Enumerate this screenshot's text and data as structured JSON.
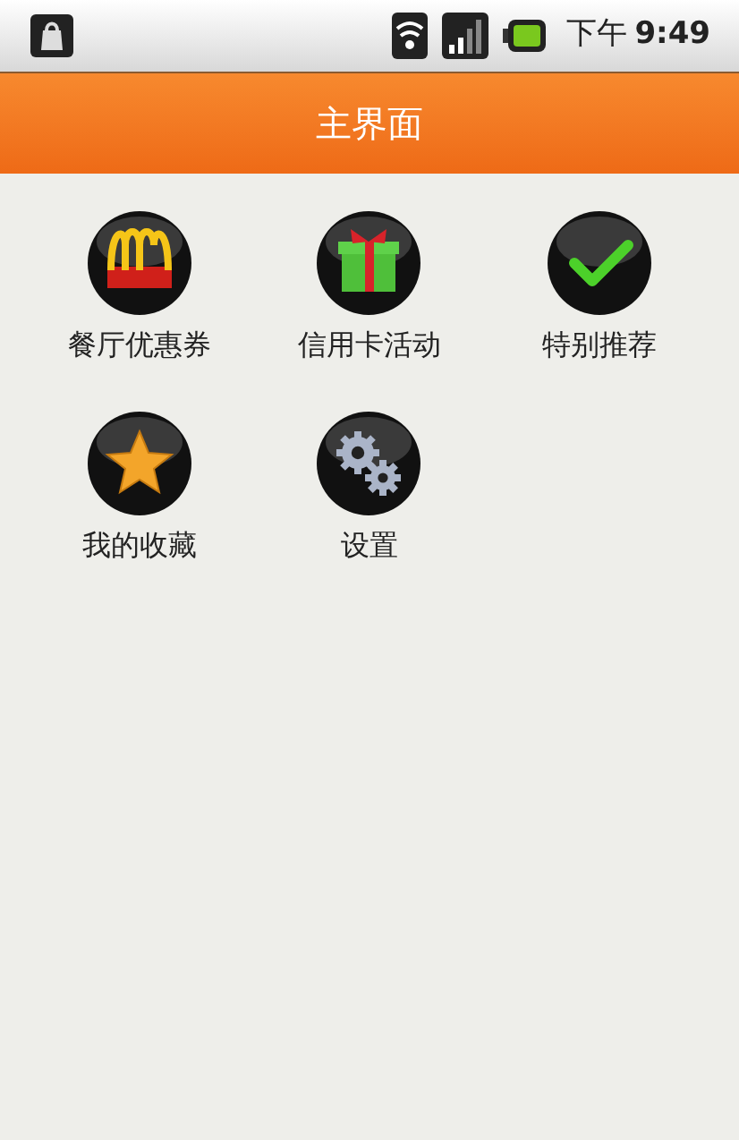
{
  "status_bar": {
    "period": "下午",
    "time": "9:49"
  },
  "title_bar": {
    "title": "主界面"
  },
  "menu": [
    {
      "label": "餐厅优惠券",
      "kind": "arches"
    },
    {
      "label": "信用卡活动",
      "kind": "gift"
    },
    {
      "label": "特别推荐",
      "kind": "check"
    },
    {
      "label": "我的收藏",
      "kind": "star"
    },
    {
      "label": "设置",
      "kind": "gears"
    }
  ]
}
